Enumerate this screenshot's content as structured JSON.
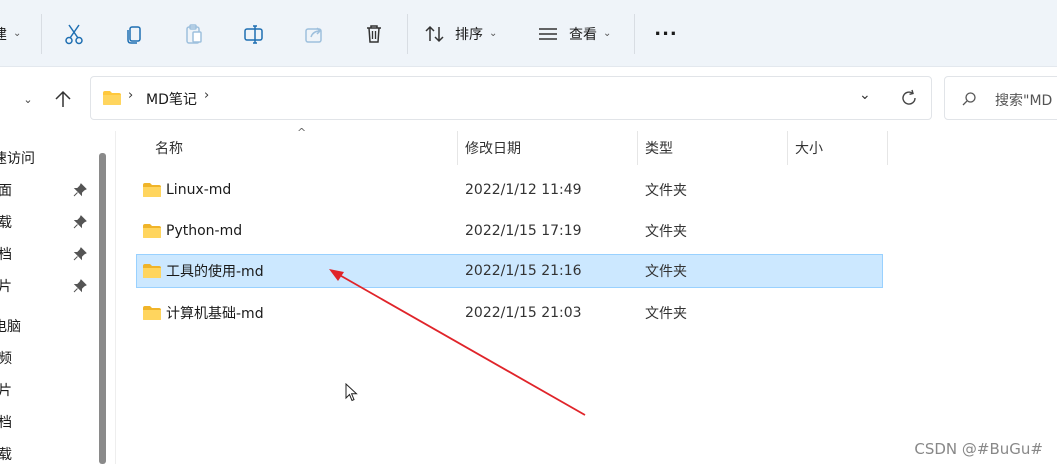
{
  "toolbar": {
    "left_partial_label": "建",
    "sort_label": "排序",
    "view_label": "查看",
    "more_label": "..."
  },
  "address": {
    "folder": "MD笔记",
    "search_placeholder": "搜索\"MD"
  },
  "nav": {
    "items": [
      {
        "label": "速访问",
        "pinned": false
      },
      {
        "label": "面",
        "pinned": true
      },
      {
        "label": "载",
        "pinned": true
      },
      {
        "label": "档",
        "pinned": true
      },
      {
        "label": "片",
        "pinned": true
      },
      {
        "label": "电脑",
        "pinned": false
      },
      {
        "label": "频",
        "pinned": false
      },
      {
        "label": "片",
        "pinned": false
      },
      {
        "label": "档",
        "pinned": false
      },
      {
        "label": "载",
        "pinned": false
      }
    ]
  },
  "columns": {
    "name": "名称",
    "date": "修改日期",
    "type": "类型",
    "size": "大小"
  },
  "files": [
    {
      "name": "Linux-md",
      "date": "2022/1/12 11:49",
      "type": "文件夹",
      "selected": false
    },
    {
      "name": "Python-md",
      "date": "2022/1/15 17:19",
      "type": "文件夹",
      "selected": false
    },
    {
      "name": "工具的使用-md",
      "date": "2022/1/15 21:16",
      "type": "文件夹",
      "selected": true
    },
    {
      "name": "计算机基础-md",
      "date": "2022/1/15 21:03",
      "type": "文件夹",
      "selected": false
    }
  ],
  "watermark": "CSDN @#BuGu#",
  "colors": {
    "toolbar_bg": "#eff4f9",
    "selection_bg": "#cce8ff",
    "selection_border": "#99d1ff",
    "folder_yellow": "#ffc83d",
    "annotation_arrow": "#e0242a"
  },
  "icons": [
    "cut-icon",
    "copy-icon",
    "paste-icon",
    "rename-icon",
    "share-icon",
    "delete-icon",
    "sort-icon",
    "view-icon",
    "more-icon",
    "folder-icon",
    "pin-icon",
    "refresh-icon",
    "search-icon",
    "up-arrow-icon",
    "chevron-down-icon",
    "breadcrumb-chevron-icon"
  ]
}
